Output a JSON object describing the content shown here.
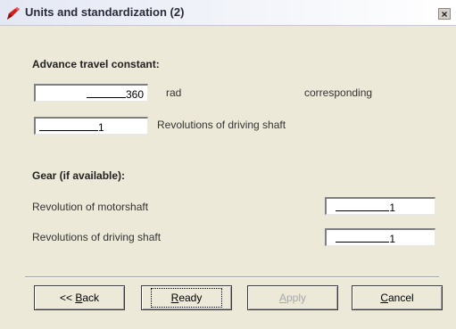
{
  "window": {
    "title": "Units and standardization (2)",
    "close_label": "×"
  },
  "advance": {
    "section_title": "Advance travel constant:",
    "value1": "360",
    "unit1": "rad",
    "note": "corresponding",
    "value2": "1",
    "unit2": "Revolutions of driving shaft"
  },
  "gear": {
    "section_title": "Gear (if available):",
    "label1": "Revolution of motorshaft",
    "value1": "1",
    "label2": "Revolutions of driving shaft",
    "value2": "1"
  },
  "buttons": {
    "back_prefix": "<< ",
    "back_mnemonic": "B",
    "back_rest": "ack",
    "ready_mnemonic": "R",
    "ready_rest": "eady",
    "apply_mnemonic": "A",
    "apply_rest": "pply",
    "cancel_mnemonic": "C",
    "cancel_rest": "ancel"
  }
}
